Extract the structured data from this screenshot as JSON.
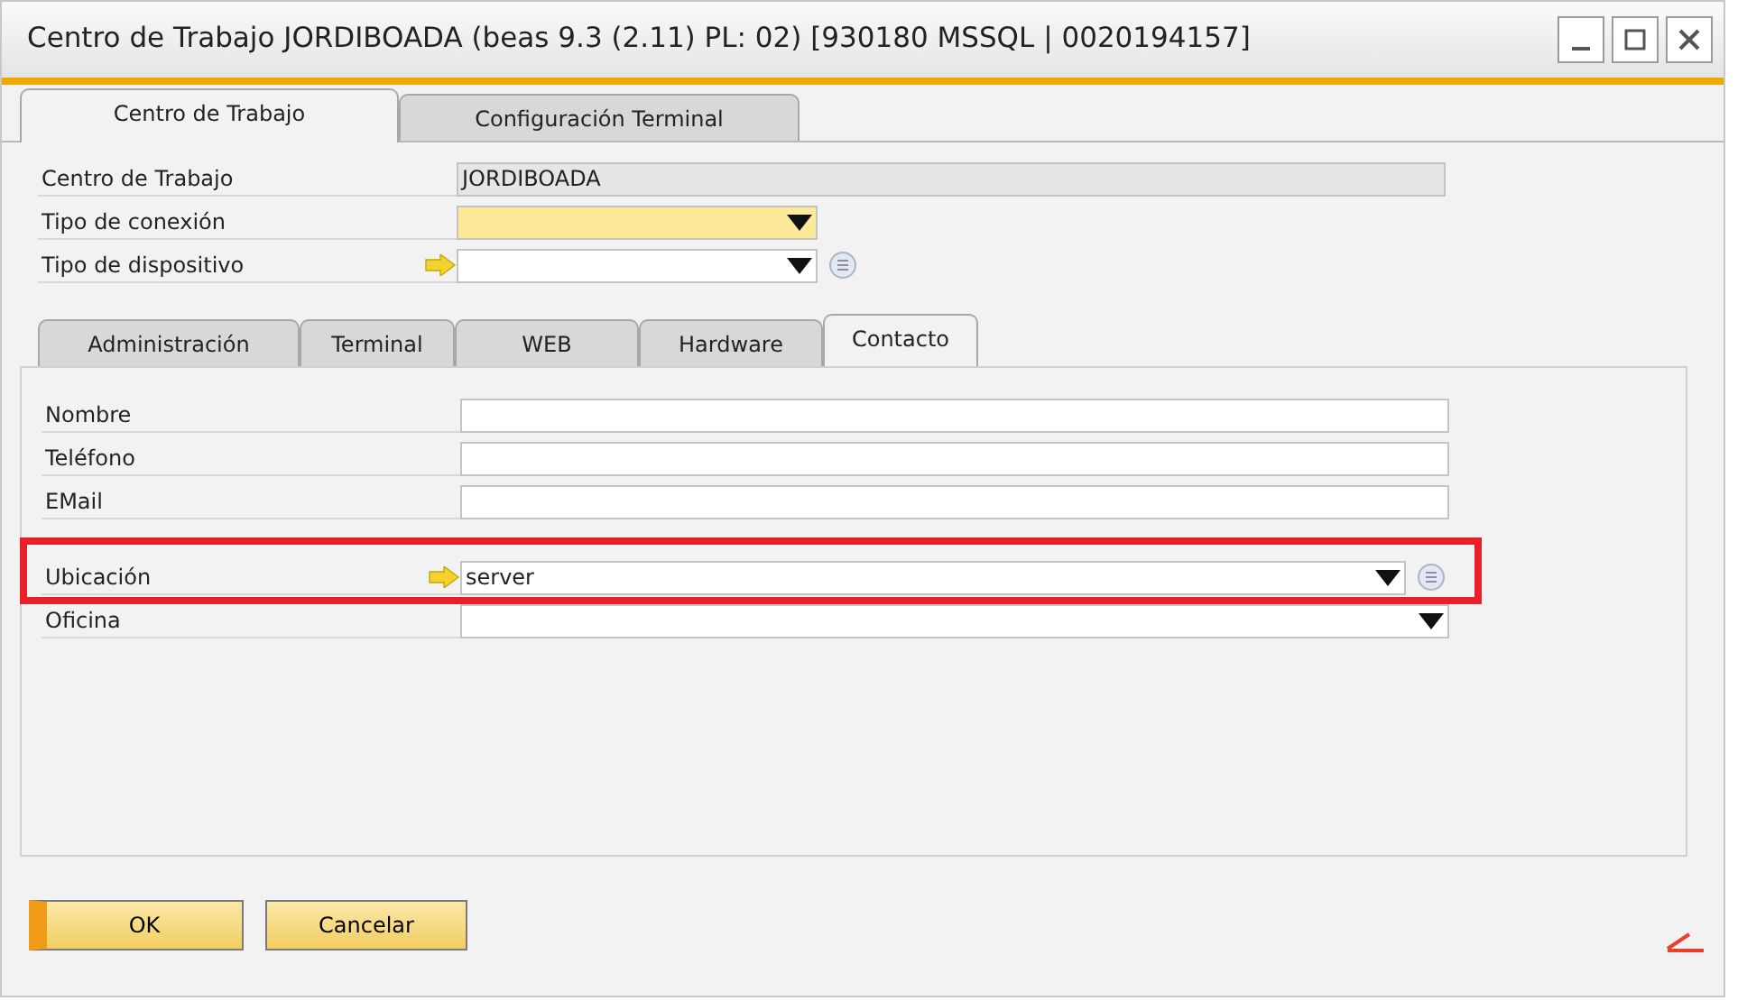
{
  "window": {
    "title": "Centro de Trabajo JORDIBOADA (beas 9.3 (2.11) PL: 02) [930180 MSSQL | 0020194157]"
  },
  "tabs": [
    {
      "label": "Centro de Trabajo",
      "selected": true
    },
    {
      "label": "Configuración Terminal",
      "selected": false
    }
  ],
  "header_fields": [
    {
      "label": "Centro de Trabajo",
      "kind": "text",
      "value": "JORDIBOADA",
      "readonly": true,
      "wide": true
    },
    {
      "label": "Tipo de conexión",
      "kind": "combo",
      "mandatory": true
    },
    {
      "label": "Tipo de dispositivo",
      "kind": "combo",
      "link_arrow": true,
      "list_icon": true
    }
  ],
  "sub_tabs": [
    {
      "label": "Administración",
      "selected": false
    },
    {
      "label": "Terminal",
      "selected": false
    },
    {
      "label": "WEB",
      "selected": false
    },
    {
      "label": "Hardware",
      "selected": false
    },
    {
      "label": "Contacto",
      "selected": true
    }
  ],
  "contact_fields": [
    {
      "label": "Nombre",
      "kind": "text"
    },
    {
      "label": "Teléfono",
      "kind": "text"
    },
    {
      "label": "EMail",
      "kind": "text"
    },
    {
      "label": "Ubicación",
      "kind": "combo",
      "value": "server",
      "link_arrow": true,
      "list_icon": true,
      "highlighted": true,
      "gap_before": true
    },
    {
      "label": "Oficina",
      "kind": "combo"
    }
  ],
  "buttons": [
    {
      "label": "OK",
      "default": true
    },
    {
      "label": "Cancelar",
      "default": false
    }
  ]
}
